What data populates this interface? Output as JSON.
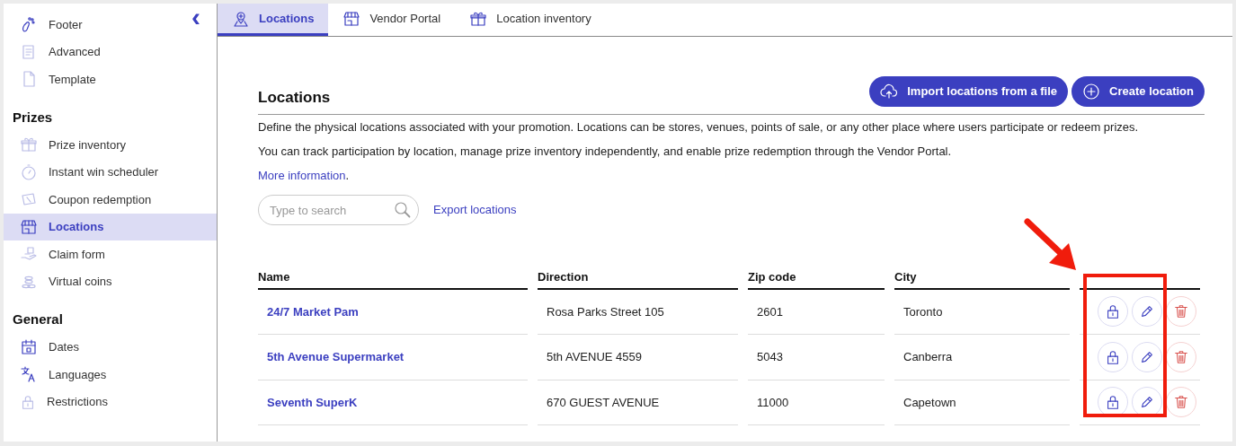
{
  "sidebar": {
    "collapse_symbol": "‹",
    "groups": [
      {
        "items": [
          {
            "label": "Footer",
            "selected": false
          },
          {
            "label": "Advanced",
            "selected": false
          },
          {
            "label": "Template",
            "selected": false
          }
        ]
      },
      {
        "heading": "Prizes",
        "items": [
          {
            "label": "Prize inventory",
            "selected": false
          },
          {
            "label": "Instant win scheduler",
            "selected": false
          },
          {
            "label": "Coupon redemption",
            "selected": false
          },
          {
            "label": "Locations",
            "selected": true
          },
          {
            "label": "Claim form",
            "selected": false
          },
          {
            "label": "Virtual coins",
            "selected": false
          }
        ]
      },
      {
        "heading": "General",
        "items": [
          {
            "label": "Dates",
            "selected": false
          },
          {
            "label": "Languages",
            "selected": false
          },
          {
            "label": "Restrictions",
            "selected": false
          }
        ]
      }
    ]
  },
  "tabs": [
    {
      "label": "Locations",
      "selected": true
    },
    {
      "label": "Vendor Portal",
      "selected": false
    },
    {
      "label": "Location inventory",
      "selected": false
    }
  ],
  "page": {
    "title": "Locations",
    "buttons": [
      {
        "label": "Import locations from a file",
        "kind": "import"
      },
      {
        "label": "Create location",
        "kind": "create"
      }
    ],
    "description": [
      "Define the physical locations associated with your promotion. Locations can be stores, venues, points of sale, or any other place where users participate or redeem prizes.",
      "You can track participation by location, manage prize inventory independently, and enable prize redemption through the Vendor Portal."
    ],
    "more_link": "More information",
    "more_suffix": ".",
    "search": {
      "placeholder": "Type to search"
    },
    "export_link": "Export locations"
  },
  "table": {
    "columns": [
      "Name",
      "Direction",
      "Zip code",
      "City"
    ],
    "rows": [
      {
        "name": "24/7 Market Pam",
        "direction": "Rosa Parks Street 105",
        "zip": "2601",
        "city": "Toronto"
      },
      {
        "name": "5th Avenue Supermarket",
        "direction": "5th AVENUE 4559",
        "zip": "5043",
        "city": "Canberra"
      },
      {
        "name": "Seventh SuperK",
        "direction": "670 GUEST AVENUE",
        "zip": "11000",
        "city": "Capetown"
      }
    ]
  },
  "annotation": {
    "kind": "arrow-and-frame"
  }
}
